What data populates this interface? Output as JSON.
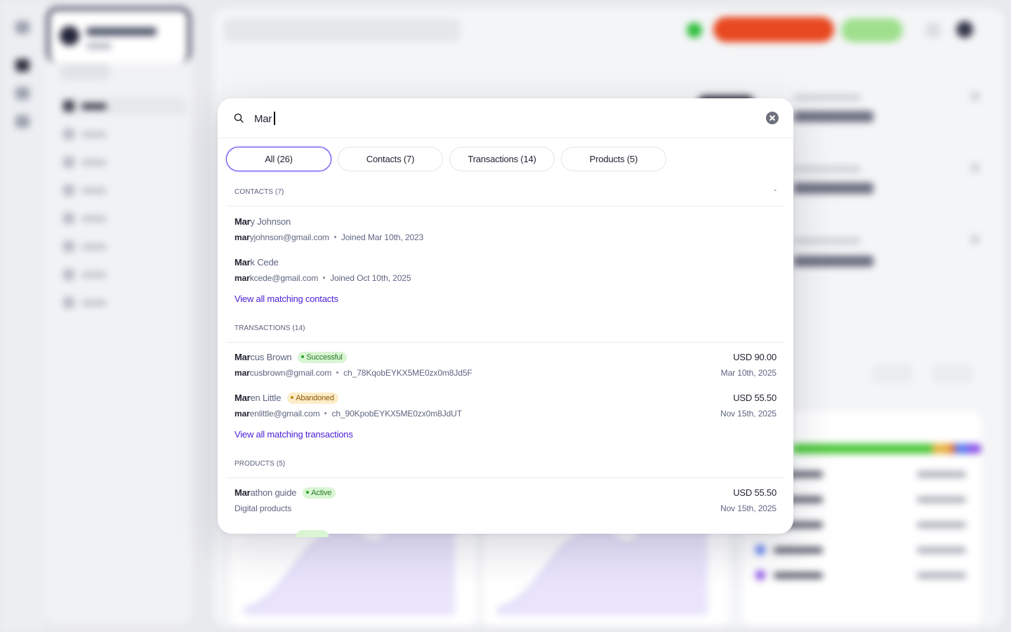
{
  "search": {
    "query": "Mar",
    "clear_label": "Clear search"
  },
  "tabs": [
    {
      "label": "All (26)",
      "active": true
    },
    {
      "label": "Contacts (7)",
      "active": false
    },
    {
      "label": "Transactions (14)",
      "active": false
    },
    {
      "label": "Products (5)",
      "active": false
    }
  ],
  "contacts": {
    "header": "CONTACTS (7)",
    "collapse_symbol": "-",
    "items": [
      {
        "name_match": "Mar",
        "name_rest": "y Johnson",
        "email_match": "mar",
        "email_rest": "yjohnson@gmail.com",
        "meta": "Joined Mar 10th, 2023"
      },
      {
        "name_match": "Mar",
        "name_rest": "k Cede",
        "email_match": "mar",
        "email_rest": "kcede@gmail.com",
        "meta": "Joined Oct 10th, 2025"
      }
    ],
    "view_all": "View all matching contacts"
  },
  "transactions": {
    "header": "TRANSACTIONS (14)",
    "items": [
      {
        "name_match": "Mar",
        "name_rest": "cus Brown",
        "status": "Successful",
        "email_match": "mar",
        "email_rest": "cusbrown@gmail.com",
        "charge_id": "ch_78KqobEYKX5ME0zx0m8Jd5F",
        "amount": "USD 90.00",
        "date": "Mar 10th, 2025"
      },
      {
        "name_match": "Mar",
        "name_rest": "en Little",
        "status": "Abandoned",
        "email_match": "mar",
        "email_rest": "enlittle@gmail.com",
        "charge_id": "ch_90KpobEYKX5ME0zx0m8JdUT",
        "amount": "USD 55.50",
        "date": "Nov 15th, 2025"
      }
    ],
    "view_all": "View all matching transactions"
  },
  "products": {
    "header": "PRODUCTS (5)",
    "items": [
      {
        "name_match": "Mar",
        "name_rest": "athon guide",
        "status": "Active",
        "category": "Digital products",
        "amount": "USD 55.50",
        "date": "Nov 15th, 2025"
      }
    ]
  },
  "colors": {
    "accent": "#4f3df0",
    "link": "#4a1ed6",
    "success_bg": "#d9f5d3",
    "warning_bg": "#fcecc8"
  },
  "icons": {
    "search": "search-icon",
    "clear": "close-circle-icon"
  }
}
